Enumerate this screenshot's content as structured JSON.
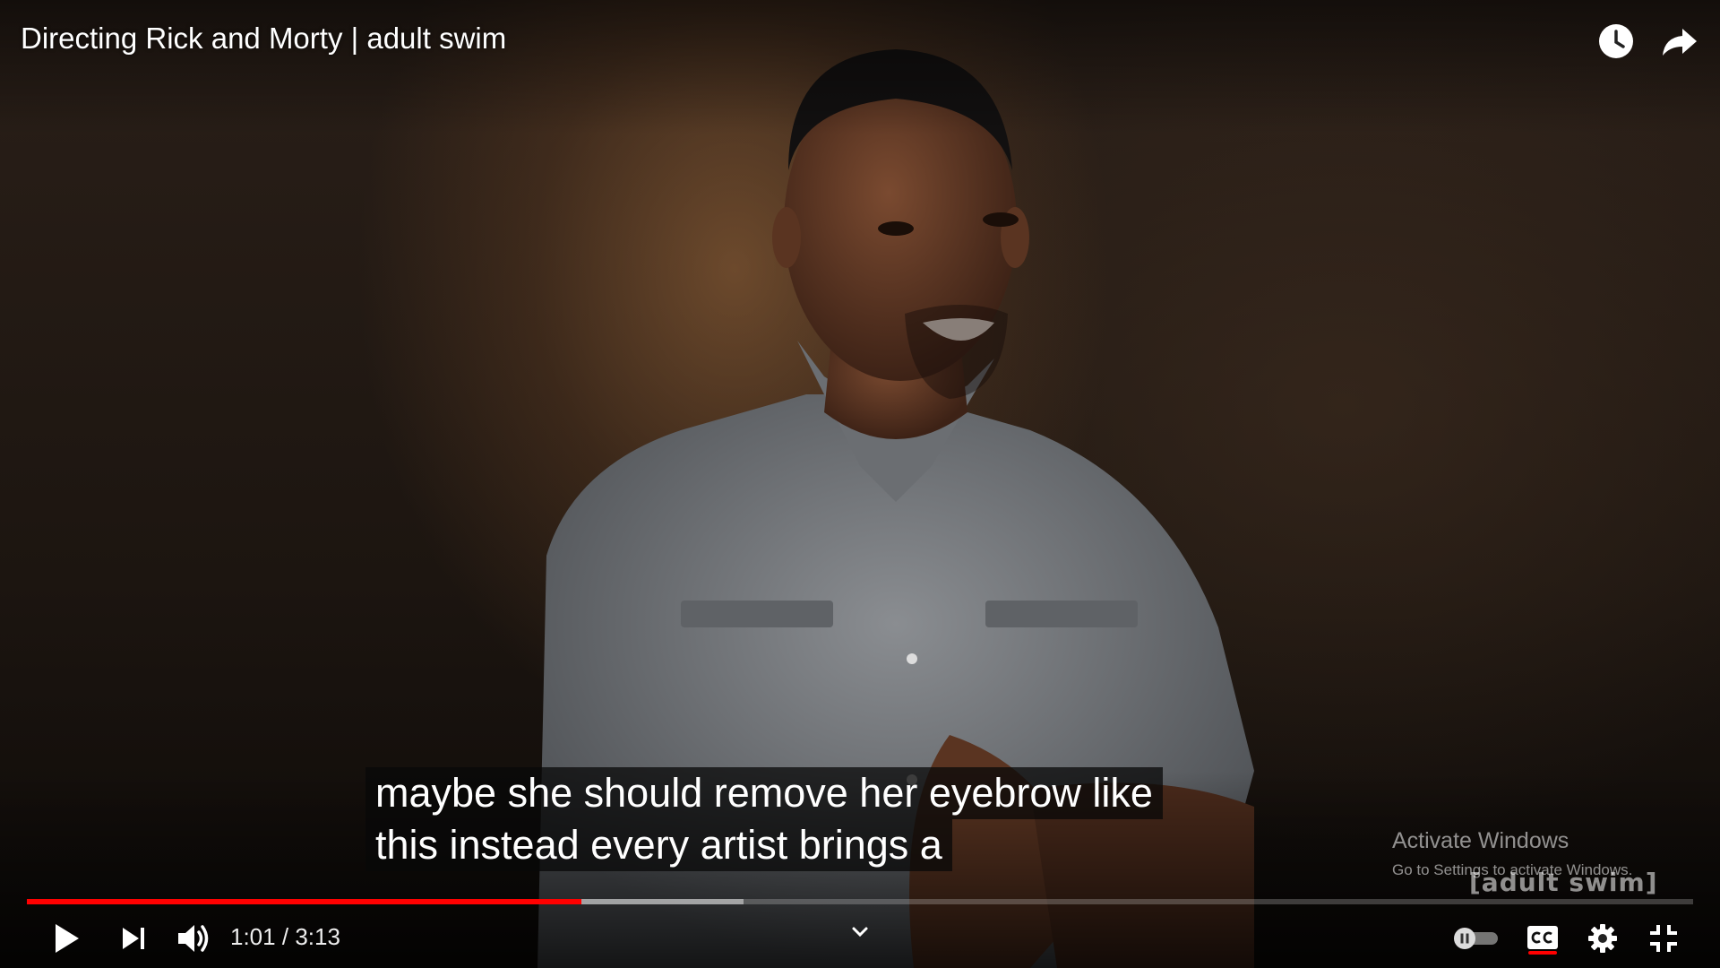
{
  "video": {
    "title": "Directing Rick and Morty | adult swim",
    "caption_lines": [
      "maybe she should remove her eyebrow like",
      "this instead every artist brings a"
    ],
    "current_time": "1:01",
    "separator": "/",
    "duration": "3:13",
    "played_fraction": 0.333,
    "loaded_fraction": 0.43,
    "watermark_logo": "[adult swim]"
  },
  "overlay": {
    "activate_title": "Activate Windows",
    "activate_sub": "Go to Settings to activate Windows."
  },
  "icons": {
    "watch_later": "clock-icon",
    "share": "share-arrow-icon",
    "play": "play-icon",
    "next": "skip-next-icon",
    "volume": "volume-icon",
    "chevron": "chevron-down-icon",
    "autoplay": "autoplay-toggle-icon",
    "captions": "cc-icon",
    "settings": "gear-icon",
    "fullscreen_exit": "fullscreen-exit-icon"
  },
  "colors": {
    "progress_played": "#ff0000",
    "cc_active": "#ff0000"
  }
}
